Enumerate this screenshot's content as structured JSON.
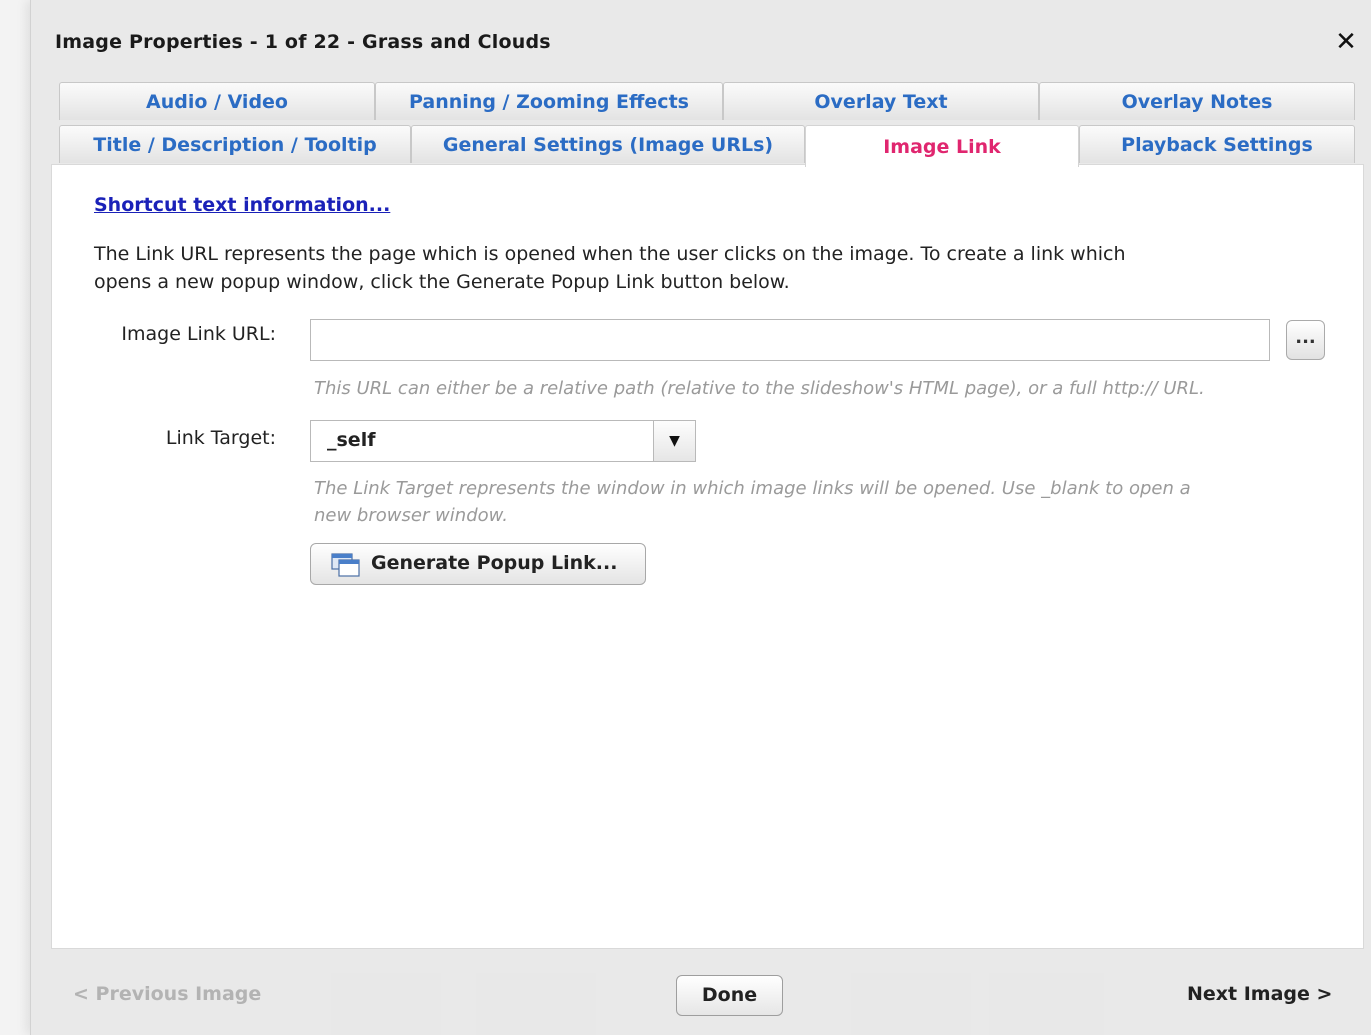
{
  "dialog": {
    "title": "Image Properties - 1 of 22 - Grass and Clouds",
    "close_icon": "close-icon"
  },
  "tabs": {
    "row1": [
      {
        "label": "Audio / Video"
      },
      {
        "label": "Panning / Zooming Effects"
      },
      {
        "label": "Overlay Text"
      },
      {
        "label": "Overlay Notes"
      }
    ],
    "row2": [
      {
        "label": "Title / Description / Tooltip"
      },
      {
        "label": "General Settings (Image URLs)"
      },
      {
        "label": "Image Link",
        "active": true
      },
      {
        "label": "Playback Settings"
      }
    ]
  },
  "panel": {
    "shortcut_link": "Shortcut text information...",
    "intro_line1": "The Link URL represents the page which is opened when the user clicks on the image.  To create a link which",
    "intro_line2": "opens a new popup window, click the Generate Popup Link button below.",
    "url_label": "Image Link URL:",
    "url_value": "",
    "browse_label": "...",
    "url_hint": "This URL can either be a relative path (relative to the slideshow's HTML page), or a full http:// URL.",
    "target_label": "Link Target:",
    "target_value": "_self",
    "target_hint_line1": "The Link Target represents the window in which image links will be opened.  Use _blank to open a",
    "target_hint_line2": "new browser window.",
    "popup_button": "Generate Popup Link..."
  },
  "footer": {
    "prev": "< Previous Image",
    "done": "Done",
    "next": "Next Image >"
  },
  "colors": {
    "tab_text": "#2b6cc4",
    "active_tab_text": "#e0266f",
    "link": "#1a21b8",
    "hint": "#9a9a9a"
  }
}
